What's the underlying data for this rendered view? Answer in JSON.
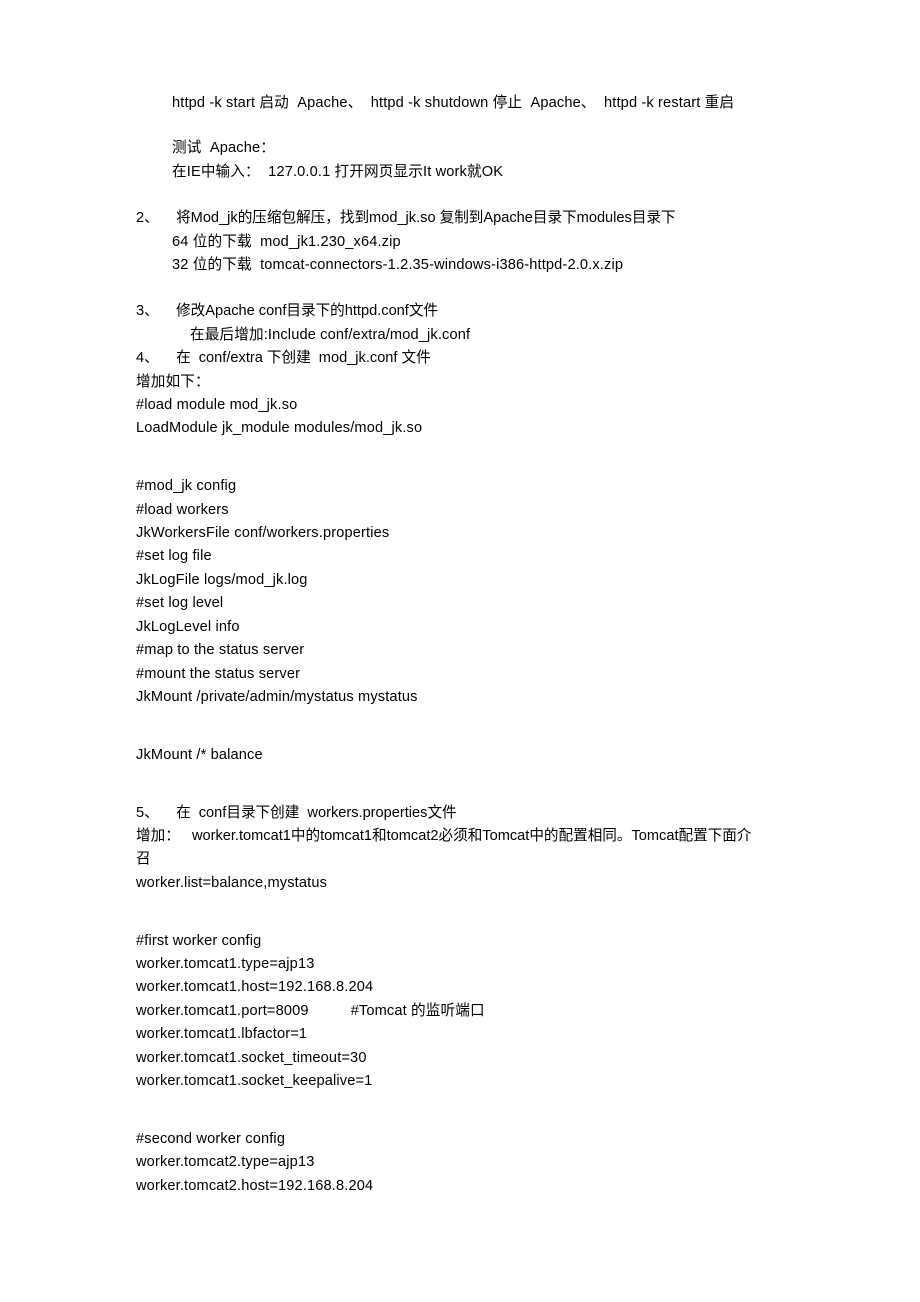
{
  "document": {
    "background_color": "#ffffff",
    "text_color": "#000000",
    "intro": {
      "commands_line": "httpd -k start 启动  Apache、  httpd -k shutdown 停止  Apache、  httpd -k restart 重启",
      "test_heading": "测试  Apache：",
      "test_line": "在IE中输入：  127.0.0.1 打开网页显示It work就OK"
    },
    "items": [
      {
        "marker": "2、",
        "title": " 将Mod_jk的压缩包解压，找到mod_jk.so 复制到Apache目录下modules目录下",
        "sublines": [
          "64 位的下载  mod_jk1.230_x64.zip",
          "32 位的下载  tomcat-connectors-1.2.35-windows-i386-httpd-2.0.x.zip"
        ]
      },
      {
        "marker": "3、",
        "title": " 修改Apache conf目录下的httpd.conf文件",
        "sublines": [
          "在最后增加:Include conf/extra/mod_jk.conf"
        ]
      },
      {
        "marker": "4、",
        "title": " 在  conf/extra 下创建  mod_jk.conf 文件",
        "sublines": []
      }
    ],
    "add_as_follows_label": "增加如下：",
    "mod_jk_conf_block_1": [
      "#load module mod_jk.so",
      "LoadModule jk_module modules/mod_jk.so"
    ],
    "mod_jk_conf_block_2": [
      "#mod_jk config",
      "#load workers",
      "JkWorkersFile conf/workers.properties",
      "#set log file",
      "JkLogFile logs/mod_jk.log",
      "#set log level",
      "JkLogLevel info",
      "#map to the status server",
      "#mount the status server",
      "JkMount /private/admin/mystatus mystatus"
    ],
    "mod_jk_conf_block_3": [
      "JkMount /* balance"
    ],
    "item_5": {
      "marker": "5、",
      "title": " 在  conf目录下创建  workers.properties文件",
      "note": "增加：   worker.tomcat1中的tomcat1和tomcat2必须和Tomcat中的配置相同。Tomcat配置下面介召",
      "worker_list": "worker.list=balance,mystatus"
    },
    "first_worker": {
      "comment": "#first worker config",
      "lines": [
        "worker.tomcat1.type=ajp13",
        "worker.tomcat1.host=192.168.8.204",
        "worker.tomcat1.port=8009          #Tomcat 的监听端口",
        "worker.tomcat1.lbfactor=1",
        "worker.tomcat1.socket_timeout=30",
        "worker.tomcat1.socket_keepalive=1"
      ]
    },
    "second_worker": {
      "comment": "#second worker config",
      "lines": [
        "worker.tomcat2.type=ajp13",
        "worker.tomcat2.host=192.168.8.204"
      ]
    }
  }
}
